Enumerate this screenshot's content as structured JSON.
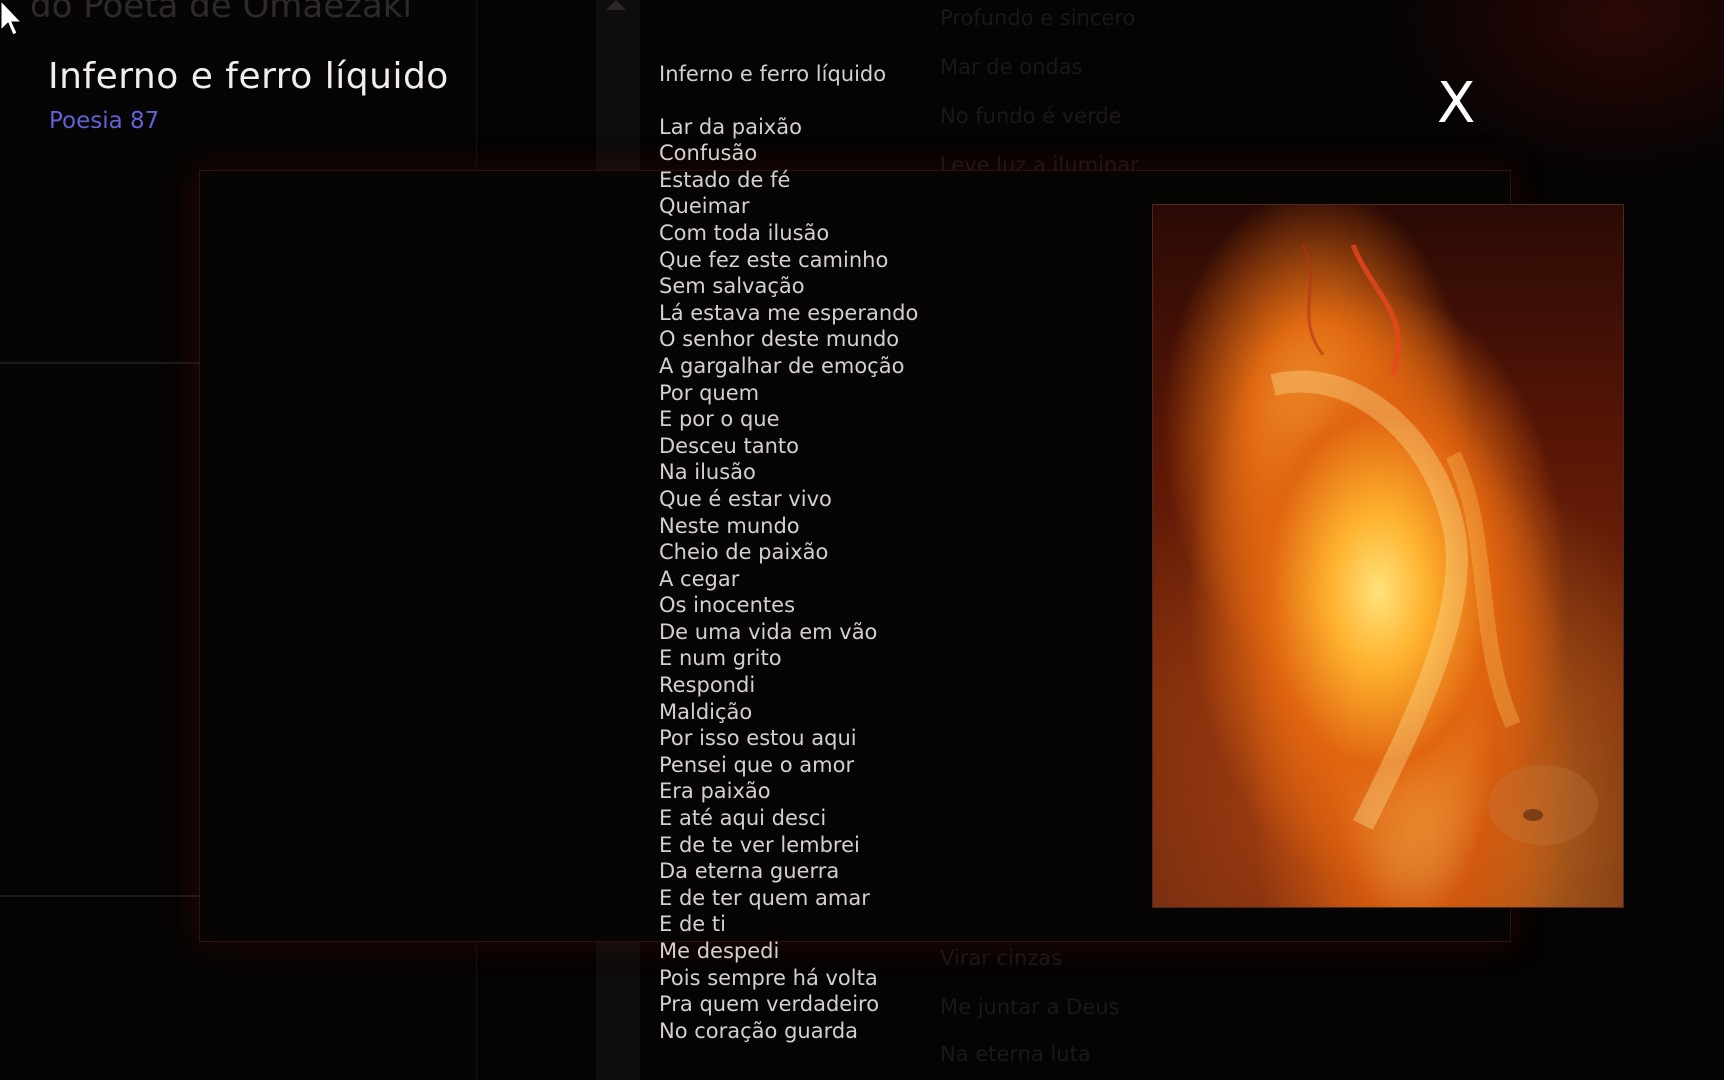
{
  "background": {
    "site_title": "do Poeta de Omaezaki",
    "list_items_top": [
      "Profundo e sincero",
      "Mar de ondas",
      "No fundo é verde",
      "Leve luz a iluminar"
    ],
    "list_items_bottom": [
      "Virar cinzas",
      "Me juntar a Deus",
      "Na eterna luta"
    ]
  },
  "poem": {
    "heading": "Inferno e ferro líquido",
    "number": "Poesia 87",
    "title_line": "Inferno e ferro líquido",
    "lines": [
      "Lar da paixão",
      "Confusão",
      "Estado de fé",
      "Queimar",
      "Com toda ilusão",
      "Que fez este caminho",
      "Sem salvação",
      "Lá estava me esperando",
      "O senhor deste mundo",
      "A gargalhar de emoção",
      "Por quem",
      "E por o que",
      "Desceu tanto",
      "Na ilusão",
      "Que é estar vivo",
      "Neste mundo",
      "Cheio de paixão",
      "A cegar",
      "Os inocentes",
      "De uma vida em vão",
      "E num grito",
      "Respondi",
      "Maldição",
      "Por isso estou aqui",
      "Pensei que o amor",
      "Era paixão",
      "E até aqui desci",
      "E de te ver lembrei",
      "Da eterna guerra",
      "E de ter quem amar",
      "E de ti",
      "Me despedi",
      "Pois sempre há volta",
      "Pra quem verdadeiro",
      "No coração guarda"
    ]
  },
  "close_label": "X",
  "colors": {
    "accent": "#5f63d6",
    "text": "#d4d0cf",
    "background": "#050303"
  },
  "icons": {
    "cursor": "arrow-cursor-icon",
    "image": "fire-artwork"
  }
}
